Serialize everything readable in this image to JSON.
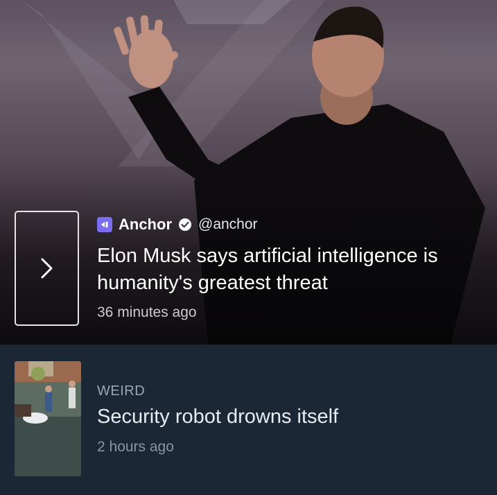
{
  "story1": {
    "source_name": "Anchor",
    "source_handle": "@anchor",
    "headline": "Elon Musk says artificial intelligence is humanity's greatest threat",
    "time": "36 minutes ago",
    "next_icon": "chevron-right-icon",
    "verified_icon": "verified-check-icon",
    "accent": "#7b6cf0"
  },
  "story2": {
    "category": "WEIRD",
    "headline": "Security robot drowns itself",
    "time": "2 hours ago"
  },
  "colors": {
    "card_background": "#1c2735",
    "headline_text": "#ffffff",
    "muted_text": "#8995a3"
  }
}
